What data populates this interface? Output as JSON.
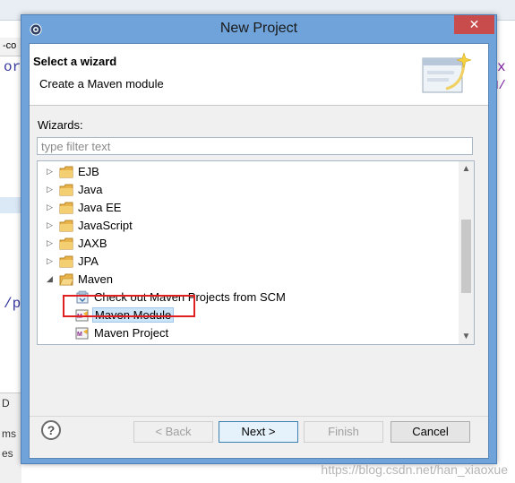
{
  "window": {
    "title": "New Project",
    "close_glyph": "✕"
  },
  "header": {
    "title": "Select a wizard",
    "description": "Create a Maven module"
  },
  "wizards": {
    "label": "Wizards:",
    "filter_placeholder": "type filter text",
    "items": [
      {
        "label": "EJB",
        "type": "folder",
        "expanded": false
      },
      {
        "label": "Java",
        "type": "folder",
        "expanded": false
      },
      {
        "label": "Java EE",
        "type": "folder",
        "expanded": false
      },
      {
        "label": "JavaScript",
        "type": "folder",
        "expanded": false
      },
      {
        "label": "JAXB",
        "type": "folder",
        "expanded": false
      },
      {
        "label": "JPA",
        "type": "folder",
        "expanded": false
      },
      {
        "label": "Maven",
        "type": "folder",
        "expanded": true
      },
      {
        "label": "Check out Maven Projects from SCM",
        "type": "item",
        "icon": "scm-checkout-icon"
      },
      {
        "label": "Maven Module",
        "type": "item",
        "icon": "maven-icon",
        "selected": true
      },
      {
        "label": "Maven Project",
        "type": "item",
        "icon": "maven-icon"
      }
    ]
  },
  "buttons": {
    "help": "?",
    "back": "< Back",
    "next": "Next >",
    "finish": "Finish",
    "cancel": "Cancel"
  },
  "background": {
    "frag_1": "-co",
    "frag_2": "or",
    "frag_3": "/p",
    "frag_4": "x",
    "frag_5": "M/",
    "bottom_1": "D",
    "bottom_2": "ms",
    "bottom_3": "es"
  },
  "watermark": "https://blog.csdn.net/han_xiaoxue"
}
